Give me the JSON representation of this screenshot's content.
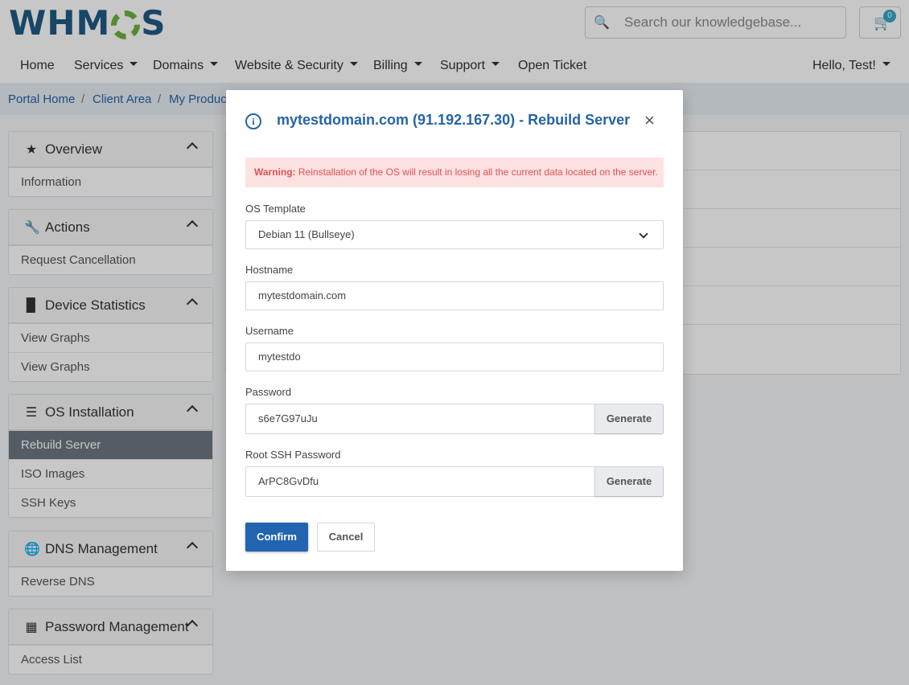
{
  "header": {
    "logo": {
      "part1": "WHM",
      "part2": "S"
    },
    "search": {
      "placeholder": "Search our knowledgebase..."
    },
    "cart": {
      "count": "0"
    }
  },
  "nav": {
    "items": [
      {
        "label": "Home"
      },
      {
        "label": "Services"
      },
      {
        "label": "Domains"
      },
      {
        "label": "Website & Security"
      },
      {
        "label": "Billing"
      },
      {
        "label": "Support"
      },
      {
        "label": "Open Ticket"
      }
    ],
    "user": "Hello, Test!"
  },
  "breadcrumb": {
    "items": [
      {
        "label": "Portal Home"
      },
      {
        "label": "Client Area"
      },
      {
        "label": "My Produc"
      }
    ],
    "separator": "/"
  },
  "sidebar": {
    "panels": [
      {
        "title": "Overview",
        "icon": "star-icon",
        "items": [
          {
            "label": "Information"
          }
        ]
      },
      {
        "title": "Actions",
        "icon": "wrench-icon",
        "items": [
          {
            "label": "Request Cancellation"
          }
        ]
      },
      {
        "title": "Device Statistics",
        "icon": "bar-chart-icon",
        "items": [
          {
            "label": "View Graphs"
          },
          {
            "label": "View Graphs"
          }
        ]
      },
      {
        "title": "OS Installation",
        "icon": "list-icon",
        "items": [
          {
            "label": "Rebuild Server",
            "active": true
          },
          {
            "label": "ISO Images"
          },
          {
            "label": "SSH Keys"
          }
        ]
      },
      {
        "title": "DNS Management",
        "icon": "globe-icon",
        "items": [
          {
            "label": "Reverse DNS"
          }
        ]
      },
      {
        "title": "Password Management",
        "icon": "table-icon",
        "items": [
          {
            "label": "Access List"
          }
        ]
      }
    ]
  },
  "modal": {
    "title": "mytestdomain.com (91.192.167.30) - Rebuild Server",
    "close": "×",
    "warning": {
      "prefix": "Warning:",
      "text": "Reinstallation of the OS will result in losing all the current data located on the server."
    },
    "fields": {
      "os_template": {
        "label": "OS Template",
        "value": "Debian 11 (Bullseye)"
      },
      "hostname": {
        "label": "Hostname",
        "value": "mytestdomain.com"
      },
      "username": {
        "label": "Username",
        "value": "mytestdo"
      },
      "password": {
        "label": "Password",
        "value": "s6e7G97uJu",
        "button": "Generate"
      },
      "root_password": {
        "label": "Root SSH Password",
        "value": "ArPC8GvDfu",
        "button": "Generate"
      }
    },
    "confirm": "Confirm",
    "cancel": "Cancel"
  },
  "colors": {
    "accent": "#2664a8",
    "confirm": "#2264b0",
    "warning_bg": "#fde2e2",
    "warning_text": "#e05050",
    "logo_blue": "#1f5a85",
    "logo_green": "#6cb33e"
  }
}
